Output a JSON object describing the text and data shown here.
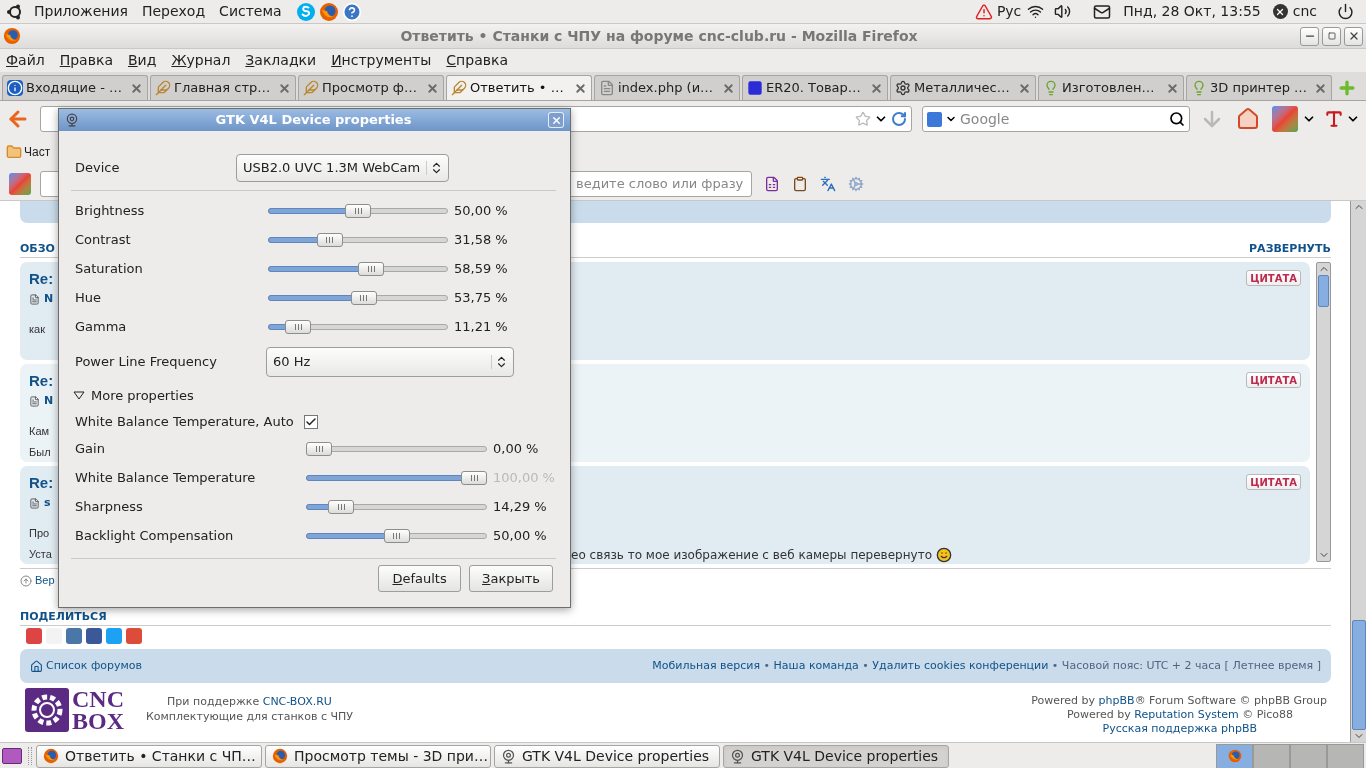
{
  "top_panel": {
    "menus": [
      "Приложения",
      "Переход",
      "Система"
    ],
    "keyboard_layout": "Рус",
    "clock": "Пнд, 28 Окт, 13:55",
    "user": "cnc"
  },
  "browser": {
    "title": "Ответить • Станки с ЧПУ на форуме cnc-club.ru - Mozilla Firefox",
    "menu": [
      "Файл",
      "Правка",
      "Вид",
      "Журнал",
      "Закладки",
      "Инструменты",
      "Справка"
    ],
    "tabs": [
      {
        "label": "Входящие - …",
        "selected": false
      },
      {
        "label": "Главная стр…",
        "selected": false
      },
      {
        "label": "Просмотр ф…",
        "selected": false
      },
      {
        "label": "Ответить • …",
        "selected": true
      },
      {
        "label": "index.php (и…",
        "selected": false
      },
      {
        "label": "ER20. Товар…",
        "selected": false
      },
      {
        "label": "Металличес…",
        "selected": false
      },
      {
        "label": "Изготовлен…",
        "selected": false
      },
      {
        "label": "3D принтер …",
        "selected": false
      }
    ],
    "search_placeholder": "Google",
    "bookmark": "Част",
    "toolbar_field_value": "ведите слово или фразу"
  },
  "page": {
    "section_fragment": "ОБЗО",
    "expand_link": "РАЗВЕРНУТЬ",
    "posts": [
      {
        "title_fragment": "Re:",
        "author_fragment": "N",
        "quote": "ЦИТАТА",
        "lines": [
          {
            "fragment": "как"
          }
        ]
      },
      {
        "title_fragment": "Re:",
        "author_fragment": "N",
        "quote": "ЦИТАТА",
        "lines": [
          {
            "fragment": "Кам"
          },
          {
            "fragment": "Был"
          }
        ]
      },
      {
        "title_fragment": "Re:",
        "author_fragment": "s",
        "quote": "ЦИТАТА",
        "lines": [
          {
            "fragment": "Про"
          },
          {
            "fragment": "Уста",
            "tail": "ео связь то мое изображение с веб камеры перевернуто"
          }
        ]
      }
    ],
    "back_to_top": "Вер",
    "share_title": "ПОДЕЛИТЬСЯ",
    "forum_link": "Список форумов",
    "footer_line": [
      {
        "text": "Мобильная версия",
        "link": true
      },
      {
        "text": " • ",
        "link": false
      },
      {
        "text": "Наша команда",
        "link": true
      },
      {
        "text": " • ",
        "link": false
      },
      {
        "text": "Удалить cookies конференции",
        "link": true
      },
      {
        "text": " • Часовой пояс: UTC + 2 часа [ Летнее время ]",
        "link": false
      }
    ],
    "logo": [
      "CNC",
      "BOX"
    ],
    "support": [
      [
        {
          "text": "При поддержке ",
          "link": false
        },
        {
          "text": "CNC-BOX.RU",
          "link": true
        }
      ],
      [
        {
          "text": "Комплектующие для станков с ЧПУ",
          "link": false
        }
      ]
    ],
    "powered": [
      [
        {
          "text": "Powered by ",
          "link": false
        },
        {
          "text": "phpBB",
          "link": true
        },
        {
          "text": "® Forum Software © phpBB Group",
          "link": false
        }
      ],
      [
        {
          "text": "Powered by ",
          "link": false
        },
        {
          "text": "Reputation System",
          "link": true
        },
        {
          "text": " © Pico88",
          "link": false
        }
      ],
      [
        {
          "text": "Русская поддержка phpBB",
          "link": true
        }
      ]
    ]
  },
  "dialog": {
    "title": "GTK V4L Device properties",
    "device_label": "Device",
    "device": "USB2.0 UVC 1.3M WebCam",
    "controls": [
      {
        "kind": "slider",
        "label": "Brightness",
        "level": 0.5,
        "reading": "50,00 %",
        "disabled": false
      },
      {
        "kind": "slider",
        "label": "Contrast",
        "level": 0.3158,
        "reading": "31,58 %",
        "disabled": false
      },
      {
        "kind": "slider",
        "label": "Saturation",
        "level": 0.5859,
        "reading": "58,59 %",
        "disabled": false
      },
      {
        "kind": "slider",
        "label": "Hue",
        "level": 0.5375,
        "reading": "53,75 %",
        "disabled": false
      },
      {
        "kind": "slider",
        "label": "Gamma",
        "level": 0.1121,
        "reading": "11,21 %",
        "disabled": false
      },
      {
        "kind": "select",
        "label": "Power Line Frequency",
        "value": "60 Hz"
      }
    ],
    "more": {
      "label": "More properties",
      "expanded": true
    },
    "more_controls": [
      {
        "kind": "checkbox",
        "label": "White Balance Temperature, Auto",
        "checked": true
      },
      {
        "kind": "slider",
        "label": "Gain",
        "level": 0,
        "reading": "0,00 %",
        "disabled": false
      },
      {
        "kind": "slider",
        "label": "White Balance Temperature",
        "level": 1,
        "reading": "100,00 %",
        "disabled": true
      },
      {
        "kind": "slider",
        "label": "Sharpness",
        "level": 0.1429,
        "reading": "14,29 %",
        "disabled": false
      },
      {
        "kind": "slider",
        "label": "Backlight Compensation",
        "level": 0.5,
        "reading": "50,00 %",
        "disabled": false
      }
    ],
    "buttons": [
      "Defaults",
      "Закрыть"
    ]
  },
  "taskbar": {
    "tasks": [
      {
        "label": "Ответить • Станки с ЧП…",
        "selected": false
      },
      {
        "label": "Просмотр темы - 3D при…",
        "selected": false
      },
      {
        "label": "GTK V4L Device properties",
        "selected": false
      },
      {
        "label": "GTK V4L Device properties",
        "selected": true
      }
    ],
    "workspaces": [
      {
        "selected": true
      },
      {
        "selected": false
      },
      {
        "selected": false
      },
      {
        "selected": false
      }
    ]
  }
}
